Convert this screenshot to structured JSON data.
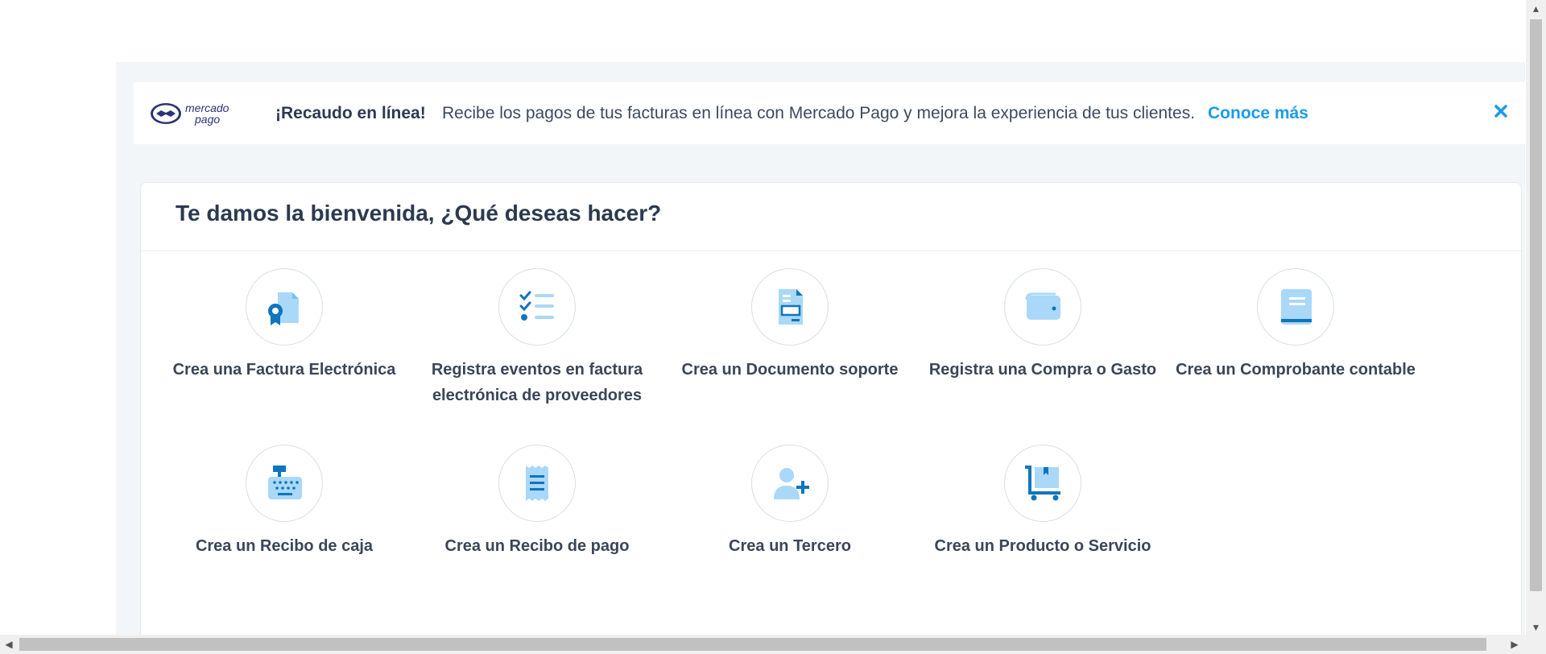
{
  "banner": {
    "logo_text": "mercado pago",
    "title": "¡Recaudo en línea!",
    "message": "Recibe los pagos de tus facturas en línea con Mercado Pago y mejora la experiencia de tus clientes.",
    "link": "Conoce más",
    "close_icon": "close-icon"
  },
  "welcome": {
    "title": "Te damos la bienvenida, ¿Qué deseas hacer?"
  },
  "actions": [
    {
      "label": "Crea una Factura Electrónica",
      "icon": "invoice-certificate-icon"
    },
    {
      "label": "Registra eventos en factura electrónica de proveedores",
      "icon": "checklist-icon"
    },
    {
      "label": "Crea un Documento soporte",
      "icon": "support-document-icon"
    },
    {
      "label": "Registra una Compra o Gasto",
      "icon": "wallet-icon"
    },
    {
      "label": "Crea un Comprobante contable",
      "icon": "accounting-book-icon"
    },
    {
      "label": "Crea un Recibo de caja",
      "icon": "cash-register-icon"
    },
    {
      "label": "Crea un Recibo de pago",
      "icon": "payment-receipt-icon"
    },
    {
      "label": "Crea un Tercero",
      "icon": "add-person-icon"
    },
    {
      "label": "Crea un Producto o Servicio",
      "icon": "product-cart-icon"
    }
  ],
  "colors": {
    "accent": "#1a9bea",
    "icon_dark": "#0f75bc",
    "icon_light": "#a9d8f8",
    "background": "#f3f6f9"
  }
}
